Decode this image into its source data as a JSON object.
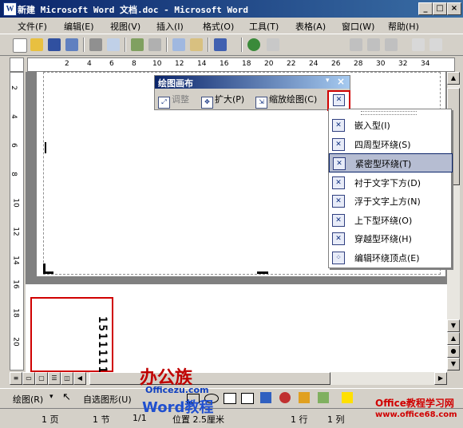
{
  "window": {
    "title": "新建 Microsoft Word 文档.doc - Microsoft Word",
    "app_icon_letter": "W",
    "minimize": "_",
    "maximize": "□",
    "close": "×"
  },
  "menubar": {
    "items": [
      "文件(F)",
      "编辑(E)",
      "视图(V)",
      "插入(I)",
      "格式(O)",
      "工具(T)",
      "表格(A)",
      "窗口(W)",
      "帮助(H)"
    ],
    "doc_close": "×"
  },
  "ruler": {
    "ticks": [
      "2",
      "4",
      "6",
      "8",
      "10",
      "12",
      "14",
      "16",
      "18",
      "20",
      "22",
      "24",
      "26",
      "28",
      "30",
      "32",
      "34"
    ],
    "vticks": [
      "2",
      "4",
      "6",
      "8",
      "10",
      "12",
      "14",
      "16",
      "18",
      "20"
    ]
  },
  "canvas_toolbar": {
    "title": "绘图画布",
    "fit": "调整",
    "expand": "扩大(P)",
    "scale": "缩放绘图(C)"
  },
  "wrap_menu": {
    "items": [
      "嵌入型(I)",
      "四周型环绕(S)",
      "紧密型环绕(T)",
      "衬于文字下方(D)",
      "浮于文字上方(N)",
      "上下型环绕(O)",
      "穿越型环绕(H)",
      "编辑环绕顶点(E)"
    ],
    "highlighted_index": 2
  },
  "doc": {
    "vertical_text": "15111111"
  },
  "drawbar": {
    "draw": "绘图(R)",
    "autoshapes": "自选图形(U)"
  },
  "status": {
    "page": "1 页",
    "section": "1 节",
    "pages": "1/1",
    "position": "位置 2.5厘米",
    "line": "1 行",
    "column": "1 列"
  },
  "watermarks": {
    "brand_cn": "办公族",
    "brand_url": "Officezu.com",
    "brand_word": "Word教程",
    "site_cn": "Office教程学习网",
    "site_url": "www.office68.com"
  },
  "colors": {
    "title_active": "#0a246a",
    "highlight_red": "#d00000",
    "menu_highlight": "#b6bdd2"
  }
}
